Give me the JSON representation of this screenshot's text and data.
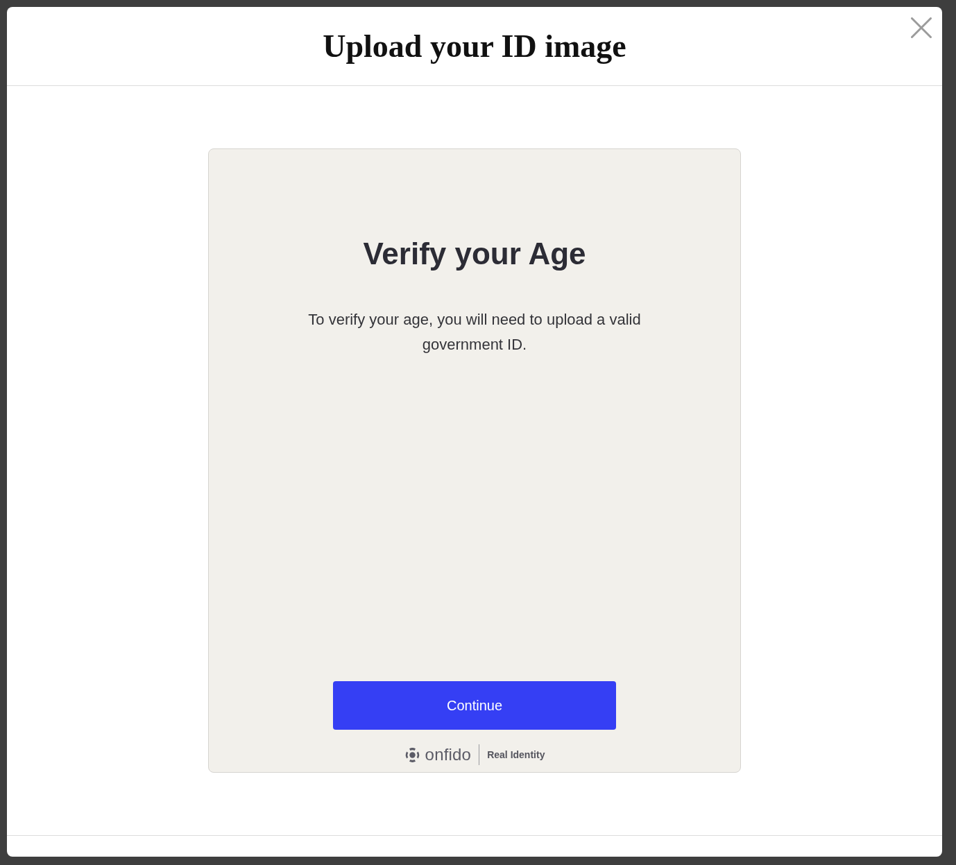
{
  "dialog": {
    "title": "Upload your ID image"
  },
  "card": {
    "heading": "Verify your Age",
    "message": "To verify your age, you will need to upload a valid government ID.",
    "button": "Continue"
  },
  "brand": {
    "name": "onfido",
    "tagline": "Real Identity"
  }
}
